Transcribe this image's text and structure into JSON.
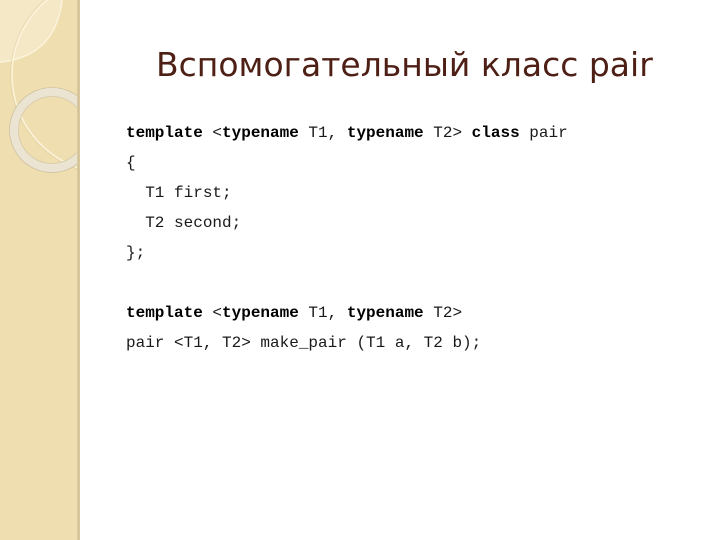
{
  "slide": {
    "title": "Вспомогательный класс pair",
    "code_lines": [
      [
        {
          "text": "template",
          "bold": true
        },
        {
          "text": " <",
          "bold": false
        },
        {
          "text": "typename",
          "bold": true
        },
        {
          "text": " T1, ",
          "bold": false
        },
        {
          "text": "typename",
          "bold": true
        },
        {
          "text": " T2> ",
          "bold": false
        },
        {
          "text": "class",
          "bold": true
        },
        {
          "text": " pair",
          "bold": false
        }
      ],
      [
        {
          "text": "{",
          "bold": false
        }
      ],
      [
        {
          "text": "  T1 first;",
          "bold": false
        }
      ],
      [
        {
          "text": "  T2 second;",
          "bold": false
        }
      ],
      [
        {
          "text": "};",
          "bold": false
        }
      ],
      [
        {
          "text": "",
          "bold": false
        }
      ],
      [
        {
          "text": "template",
          "bold": true
        },
        {
          "text": " <",
          "bold": false
        },
        {
          "text": "typename",
          "bold": true
        },
        {
          "text": " T1, ",
          "bold": false
        },
        {
          "text": "typename",
          "bold": true
        },
        {
          "text": " T2>",
          "bold": false
        }
      ],
      [
        {
          "text": "pair <T1, T2> make_pair (T1 a, T2 b);",
          "bold": false
        }
      ]
    ]
  },
  "theme": {
    "title_color": "#4d1f15",
    "band_color": "#efdeb0"
  }
}
